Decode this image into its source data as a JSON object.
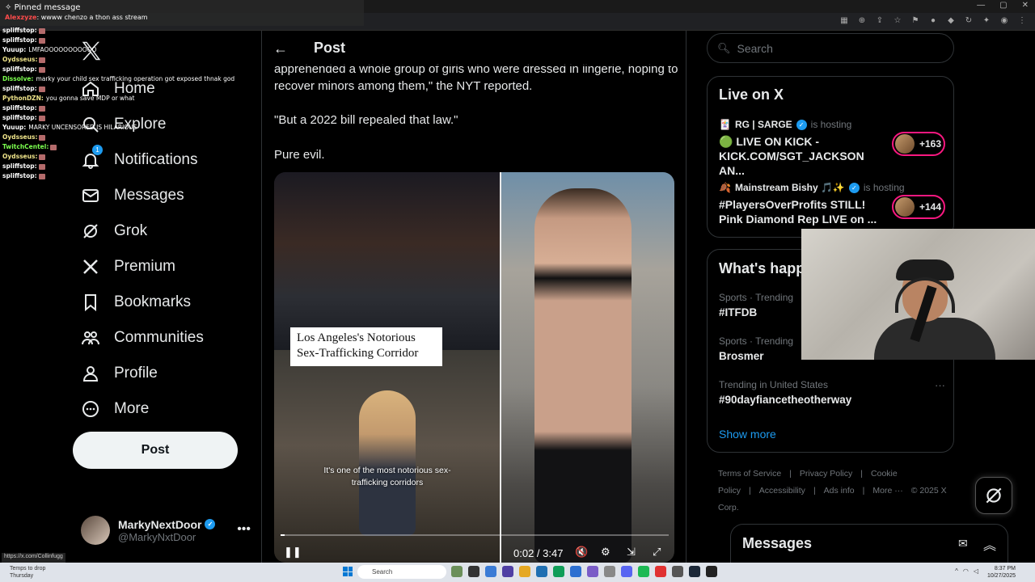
{
  "chat": {
    "pinned_title": "Pinned message",
    "pinned_user": "Alexzyze",
    "pinned_text": ": wwww chenzo a thon ass stream",
    "lines": [
      {
        "user": "spliffstop:",
        "text": "",
        "color": "#ffffff"
      },
      {
        "user": "spliffstop:",
        "text": "",
        "color": "#ffffff"
      },
      {
        "user": "Yuuup:",
        "text": "LMFAOOOOOOOOOOO",
        "color": "#ffffff"
      },
      {
        "user": "Oydsseus:",
        "text": "",
        "color": "#f0e58a"
      },
      {
        "user": "spliffstop:",
        "text": "",
        "color": "#ffffff"
      },
      {
        "user": "Dissolve:",
        "text": "marky your child sex trafficking operation got exposed thnak god",
        "color": "#7cff4f"
      },
      {
        "user": "spliffstop:",
        "text": "",
        "color": "#ffffff"
      },
      {
        "user": "PythonDZN:",
        "text": "you gonna save MDP or what",
        "color": "#f0e58a"
      },
      {
        "user": "spliffstop:",
        "text": "",
        "color": "#ffffff"
      },
      {
        "user": "spliffstop:",
        "text": "",
        "color": "#ffffff"
      },
      {
        "user": "Yuuup:",
        "text": "MARKY UNCENSORED IS HILARIOUS",
        "color": "#ffffff"
      },
      {
        "user": "Oydsseus:",
        "text": "",
        "color": "#f0e58a"
      },
      {
        "user": "TwitchCentel:",
        "text": "",
        "color": "#7cff4f"
      },
      {
        "user": "Oydsseus:",
        "text": "",
        "color": "#f0e58a"
      },
      {
        "user": "spliffstop:",
        "text": "",
        "color": "#ffffff"
      },
      {
        "user": "spliffstop:",
        "text": "",
        "color": "#ffffff"
      }
    ]
  },
  "nav": {
    "items": [
      {
        "label": "Home",
        "icon": "home-icon"
      },
      {
        "label": "Explore",
        "icon": "search-icon"
      },
      {
        "label": "Notifications",
        "icon": "bell-icon",
        "badge": "1"
      },
      {
        "label": "Messages",
        "icon": "envelope-icon"
      },
      {
        "label": "Grok",
        "icon": "grok-icon"
      },
      {
        "label": "Premium",
        "icon": "x-logo-icon"
      },
      {
        "label": "Bookmarks",
        "icon": "bookmark-icon"
      },
      {
        "label": "Communities",
        "icon": "people-icon"
      },
      {
        "label": "Profile",
        "icon": "person-icon"
      },
      {
        "label": "More",
        "icon": "more-circle-icon"
      }
    ],
    "post_button": "Post",
    "account": {
      "display_name": "MarkyNextDoor",
      "handle": "@MarkyNxtDoor"
    }
  },
  "main": {
    "header_title": "Post",
    "paragraphs": [
      "apprehended a whole group of girls who were dressed in lingerie, hoping to recover minors among them,\" the NYT reported.",
      "\"But a 2022 bill repealed that law.\"",
      "Pure evil."
    ],
    "video": {
      "headline": "Los Angeles's Notorious Sex-Trafficking Corridor",
      "caption": "It's one of the most notorious sex-trafficking corridors",
      "time": "0:02 / 3:47",
      "progress": 0.01
    }
  },
  "right": {
    "search_placeholder": "Search",
    "live": {
      "title": "Live on X",
      "entries": [
        {
          "host": "RG | SARGE",
          "hosting": "is hosting",
          "title": "🟢 LIVE ON KICK - KICK.COM/SGT_JACKSON AN...",
          "count": "+163"
        },
        {
          "host": "Mainstream Bishy 🎵✨",
          "hosting": "is hosting",
          "title": "#PlayersOverProfits STILL! Pink Diamond Rep LIVE on ...",
          "count": "+144"
        }
      ]
    },
    "happening": {
      "title": "What's happ",
      "trends": [
        {
          "meta": "Sports · Trending",
          "name": "#ITFDB"
        },
        {
          "meta": "Sports · Trending",
          "name": "Brosmer"
        },
        {
          "meta": "Trending in United States",
          "name": "#90dayfiancetheotherway"
        }
      ],
      "show_more": "Show more"
    },
    "footer": [
      "Terms of Service",
      "|",
      "Privacy Policy",
      "|",
      "Cookie Policy",
      "|",
      "Accessibility",
      "|",
      "Ads info",
      "|",
      "More ···",
      "© 2025 X Corp."
    ]
  },
  "messages_drawer": {
    "title": "Messages"
  },
  "status_url": "https://x.com/Collinfugg",
  "taskbar": {
    "weather_1": "Temps to drop",
    "weather_2": "Thursday",
    "search_placeholder": "Search",
    "time": "8:37 PM",
    "date": "10/27/2025"
  },
  "colors": {
    "accent": "#1d9bf0",
    "live_ring": "#f91880",
    "background": "#000000"
  }
}
